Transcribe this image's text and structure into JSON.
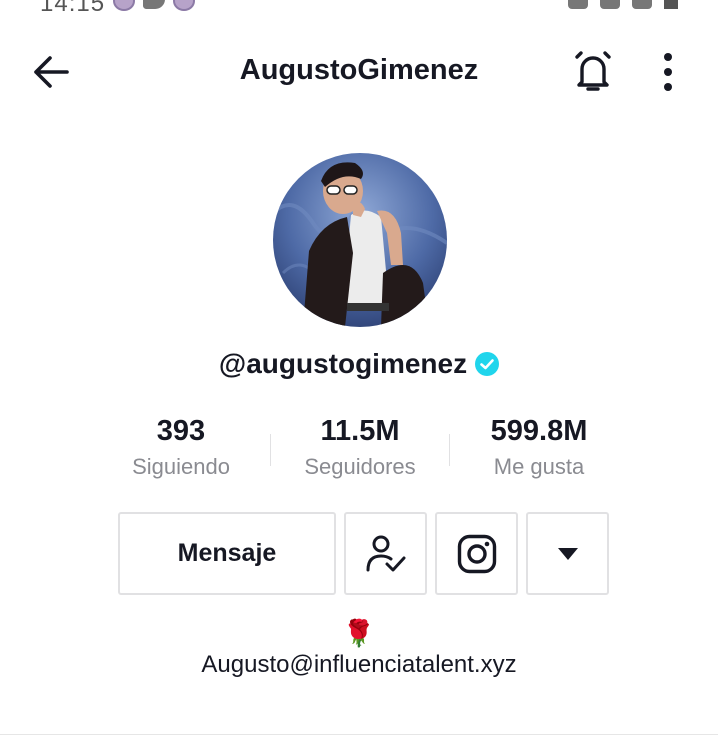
{
  "status_bar": {
    "time": "14:15"
  },
  "header": {
    "title": "AugustoGimenez",
    "icons": {
      "back": "arrow-left-icon",
      "bell": "bell-icon",
      "more": "vertical-dots-icon"
    }
  },
  "profile": {
    "handle": "@augustogimenez",
    "verified": true,
    "verified_color": "#20d5ec"
  },
  "stats": [
    {
      "value": "393",
      "label": "Siguiendo"
    },
    {
      "value": "11.5M",
      "label": "Seguidores"
    },
    {
      "value": "599.8M",
      "label": "Me gusta"
    }
  ],
  "actions": {
    "message_label": "Mensaje",
    "icons": {
      "following": "person-check-icon",
      "instagram": "instagram-icon",
      "dropdown": "caret-down-icon"
    }
  },
  "bio": {
    "emoji": "🌹",
    "text": "Augusto@influenciatalent.xyz"
  },
  "colors": {
    "text": "#161823",
    "secondary": "#8a8b91",
    "border": "#e1e1e3"
  }
}
